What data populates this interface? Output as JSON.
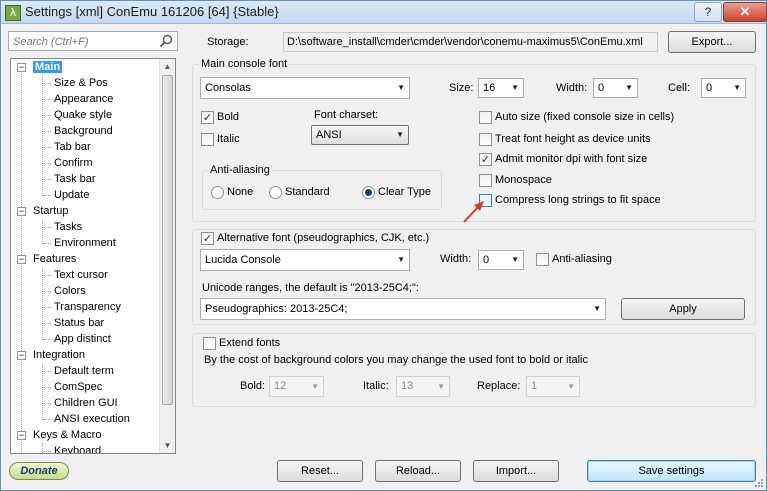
{
  "window": {
    "title": "Settings [xml] ConEmu 161206 [64] {Stable}",
    "app_icon": "λ",
    "help_label": "?",
    "close_label": "✕"
  },
  "search": {
    "placeholder": "Search (Ctrl+F)"
  },
  "tree": [
    {
      "label": "Main",
      "level": 0,
      "expanded": true,
      "selected": true
    },
    {
      "label": "Size & Pos",
      "level": 1
    },
    {
      "label": "Appearance",
      "level": 1
    },
    {
      "label": "Quake style",
      "level": 1
    },
    {
      "label": "Background",
      "level": 1
    },
    {
      "label": "Tab bar",
      "level": 1
    },
    {
      "label": "Confirm",
      "level": 1
    },
    {
      "label": "Task bar",
      "level": 1
    },
    {
      "label": "Update",
      "level": 1
    },
    {
      "label": "Startup",
      "level": 0,
      "expanded": true
    },
    {
      "label": "Tasks",
      "level": 1
    },
    {
      "label": "Environment",
      "level": 1
    },
    {
      "label": "Features",
      "level": 0,
      "expanded": true
    },
    {
      "label": "Text cursor",
      "level": 1
    },
    {
      "label": "Colors",
      "level": 1
    },
    {
      "label": "Transparency",
      "level": 1
    },
    {
      "label": "Status bar",
      "level": 1
    },
    {
      "label": "App distinct",
      "level": 1
    },
    {
      "label": "Integration",
      "level": 0,
      "expanded": true
    },
    {
      "label": "Default term",
      "level": 1
    },
    {
      "label": "ComSpec",
      "level": 1
    },
    {
      "label": "Children GUI",
      "level": 1
    },
    {
      "label": "ANSI execution",
      "level": 1
    },
    {
      "label": "Keys & Macro",
      "level": 0,
      "expanded": true
    },
    {
      "label": "Keyboard",
      "level": 1
    }
  ],
  "storage": {
    "label": "Storage:",
    "path": "D:\\software_install\\cmder\\cmder\\vendor\\conemu-maximus5\\ConEmu.xml",
    "export_label": "Export..."
  },
  "main_font": {
    "group_label": "Main console font",
    "font_name": "Consolas",
    "size_label": "Size:",
    "size_value": "16",
    "width_label": "Width:",
    "width_value": "0",
    "cell_label": "Cell:",
    "cell_value": "0",
    "bold_label": "Bold",
    "bold_checked": true,
    "italic_label": "Italic",
    "italic_checked": false,
    "charset_label": "Font charset:",
    "charset_value": "ANSI",
    "antialias_label": "Anti-aliasing",
    "aa_none": "None",
    "aa_standard": "Standard",
    "aa_cleartype": "Clear Type",
    "aa_selected": "Clear Type",
    "autosize_label": "Auto size (fixed console size in cells)",
    "autosize_checked": false,
    "treat_height_label": "Treat font height as device units",
    "treat_height_checked": false,
    "admit_dpi_label": "Admit monitor dpi with font size",
    "admit_dpi_checked": true,
    "monospace_label": "Monospace",
    "monospace_checked": false,
    "compress_label": "Compress long strings to fit space",
    "compress_checked": false
  },
  "alt_font": {
    "checkbox_label": "Alternative font (pseudographics, CJK, etc.)",
    "checked": true,
    "font_name": "Lucida Console",
    "width_label": "Width:",
    "width_value": "0",
    "antialias_label": "Anti-aliasing",
    "antialias_checked": false,
    "unicode_label": "Unicode ranges, the default is \"2013-25C4;\":",
    "unicode_value": "Pseudographics: 2013-25C4;",
    "apply_label": "Apply"
  },
  "extend_fonts": {
    "checkbox_label": "Extend fonts",
    "checked": false,
    "description": "By the cost of background colors you may change the used font to bold or italic",
    "bold_label": "Bold:",
    "bold_value": "12",
    "italic_label": "Italic:",
    "italic_value": "13",
    "replace_label": "Replace:",
    "replace_value": "1"
  },
  "footer": {
    "donate_label": "Donate",
    "reset_label": "Reset...",
    "reload_label": "Reload...",
    "import_label": "Import...",
    "save_label": "Save settings"
  },
  "colors": {
    "annotation_arrow": "#e53030",
    "selection": "#3399ff"
  }
}
